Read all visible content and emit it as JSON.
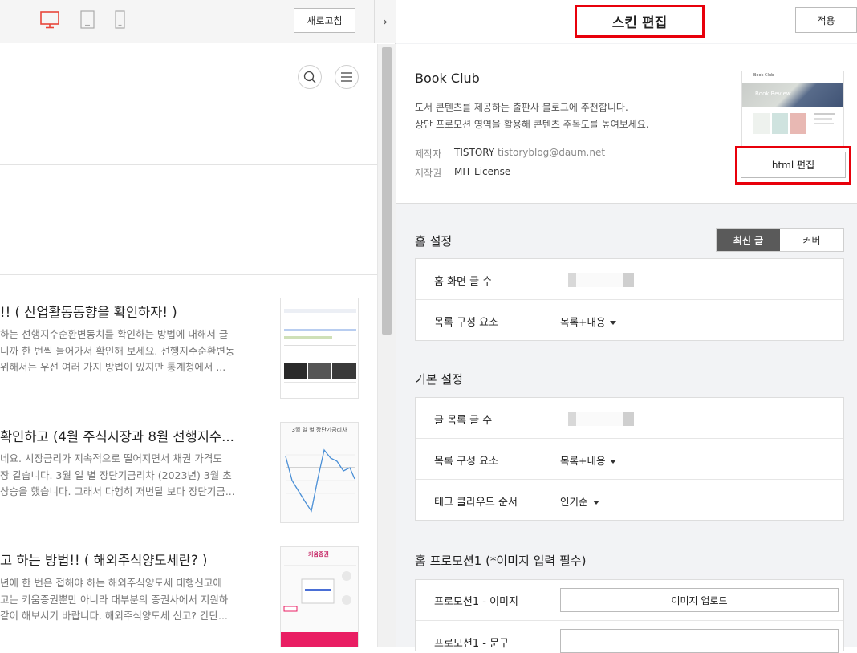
{
  "toolbar": {
    "refresh_label": "새로고침",
    "devices": [
      "desktop-icon",
      "tablet-icon",
      "mobile-icon"
    ],
    "collapse_glyph": "›",
    "active_color": "#e8463a"
  },
  "preview": {
    "posts": [
      {
        "title": "!! ( 산업활동동향을 확인하자! )",
        "excerpt": [
          "하는 선행지수순환변동치를 확인하는 방법에 대해서 글",
          "니까 한 번씩 들어가서 확인해 보세요. 선행지수순환변동",
          "위해서는 우선 여러 가지 방법이 있지만 통계청에서 ..."
        ]
      },
      {
        "title": "확인하고 (4월 주식시장과 8월 선행지수...",
        "excerpt": [
          "네요. 시장금리가 지속적으로 떨어지면서 채권 가격도",
          "장 같습니다. 3월 일 별 장단기금리차 (2023년) 3월 초",
          "상승을 했습니다. 그래서 다행히 저번달 보다 장단기금..."
        ]
      },
      {
        "title": "고 하는 방법!! ( 해외주식양도세란? )",
        "excerpt": [
          "년에 한 번은 접해야 하는 해외주식양도세 대행신고에",
          "고는 키움증권뿐만 아니라 대부분의 증권사에서 지원하",
          "같이 해보시기 바랍니다. 해외주식양도세 신고? 간단..."
        ]
      }
    ],
    "thumb2_title": "3월 일 별 장단기금리차",
    "thumb3_brand": "키움증권"
  },
  "panel": {
    "title": "스킨 편집",
    "apply_label": "적용",
    "skin": {
      "name": "Book Club",
      "desc1": "도서 콘텐츠를 제공하는 출판사 블로그에 추천합니다.",
      "desc2": "상단 프로모션 영역을 활용해 콘텐츠 주목도를 높여보세요.",
      "author_key": "제작자",
      "author_name": "TISTORY",
      "author_email": "tistoryblog@daum.net",
      "license_key": "저작권",
      "license": "MIT License",
      "thumb_label": "Book Review",
      "thumb_brand": "Book Club",
      "html_edit_label": "html 편집"
    },
    "home": {
      "title": "홈 설정",
      "seg_latest": "최신 글",
      "seg_cover": "커버",
      "post_count_label": "홈 화면 글 수",
      "list_elem_label": "목록 구성 요소",
      "list_elem_value": "목록+내용"
    },
    "basic": {
      "title": "기본 설정",
      "post_count_label": "글 목록 글 수",
      "list_elem_label": "목록 구성 요소",
      "list_elem_value": "목록+내용",
      "tag_order_label": "태그 클라우드 순서",
      "tag_order_value": "인기순"
    },
    "promo": {
      "title": "홈 프로모션1 (*이미지 입력 필수)",
      "image_label": "프로모션1 - 이미지",
      "upload_label": "이미지 업로드",
      "text_label": "프로모션1 - 문구"
    }
  },
  "colors": {
    "highlight": "#e8000b",
    "segment_active": "#5a5a5a",
    "panel_bg": "#f2f3f5"
  }
}
